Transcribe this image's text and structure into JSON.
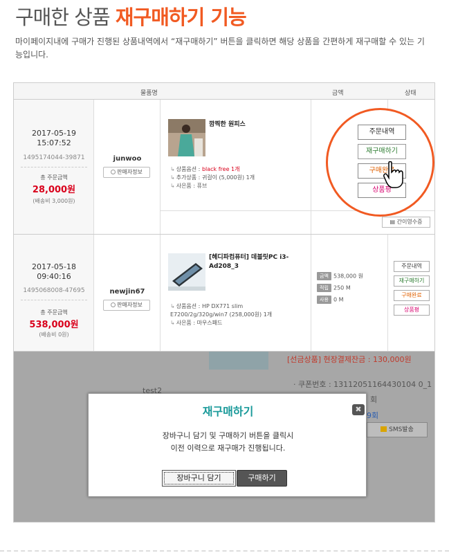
{
  "headline": {
    "prefix": "구매한 상품 ",
    "highlight": "재구매하기 기능"
  },
  "description": "마이페이지내에 구매가 진행된 상품내역에서 “재구매하기” 버튼을 클릭하면 해당 상품을 간편하게 재구매할 수 있는 기능입니다.",
  "table": {
    "headers": {
      "product": "물품명",
      "amount": "금액",
      "status": "상태"
    },
    "orders": [
      {
        "date": "2017-05-19",
        "time": "15:07:52",
        "order_no": "1495174044-39871",
        "total_label": "총 주문금액",
        "total": "28,000원",
        "shipping": "(배송비 3,000원)",
        "user": "junwoo",
        "seller_btn": "판매자정보",
        "product_name": "깜찍한 원피스",
        "options": [
          {
            "label": "상품옵션 :",
            "value": "black free 1개",
            "red": true
          },
          {
            "label": "추가상품 :",
            "value": "귀걸이 (5,000원) 1개",
            "red": false
          },
          {
            "label": "사은품 :",
            "value": "퓨브",
            "red": false
          }
        ],
        "memo_btn": "간이영수증"
      },
      {
        "date": "2017-05-18",
        "time": "09:40:16",
        "order_no": "1495068008-47695",
        "total_label": "총 주문금액",
        "total": "538,000원",
        "shipping": "(배송비 0원)",
        "user": "newjin67",
        "seller_btn": "판매자정보",
        "product_name_1": "[헤디파컴퓨터] 데블릿PC i3-",
        "product_name_2": "Ad208_3",
        "options": [
          {
            "label": "상품옵션 :",
            "value": "HP DX771 slim",
            "red": false
          },
          {
            "label": "",
            "value": "E7200/2g/320g/win7 (258,000원) 1개",
            "red": false
          },
          {
            "label": "사은품 :",
            "value": "마우스패드",
            "red": false
          }
        ],
        "price_rows": [
          {
            "tag": "금액",
            "value": "538,000 원"
          },
          {
            "tag": "적립",
            "value": "250 M"
          },
          {
            "tag": "사용",
            "value": "0 M"
          }
        ],
        "status_buttons": [
          "주문내역",
          "재구매하기",
          "구매완료",
          "상품평"
        ]
      }
    ]
  },
  "magnifier": {
    "buttons": [
      "주문내역",
      "재구매하기",
      "구매완료",
      "상품평"
    ]
  },
  "background_overlay": {
    "user": "test2",
    "promo": "[선금상품] 현장결제잔금 : 130,000원",
    "coupon": "· 쿠폰번호 : 13112051164430104 0_1",
    "count1": "회",
    "count2": "9회",
    "sms_btn": "SMS발송"
  },
  "modal": {
    "title": "재구매하기",
    "close": "✖",
    "message_1": "장바구니 담기 및 구매하기 버튼을 클릭시",
    "message_2": "이전 이력으로 재구매가 진행됩니다.",
    "cart_btn": "장바구니 담기",
    "buy_btn": "구매하기"
  },
  "colors": {
    "accent": "#f15a22",
    "price_red": "#d9001b",
    "modal_title": "#1a9a9a"
  }
}
